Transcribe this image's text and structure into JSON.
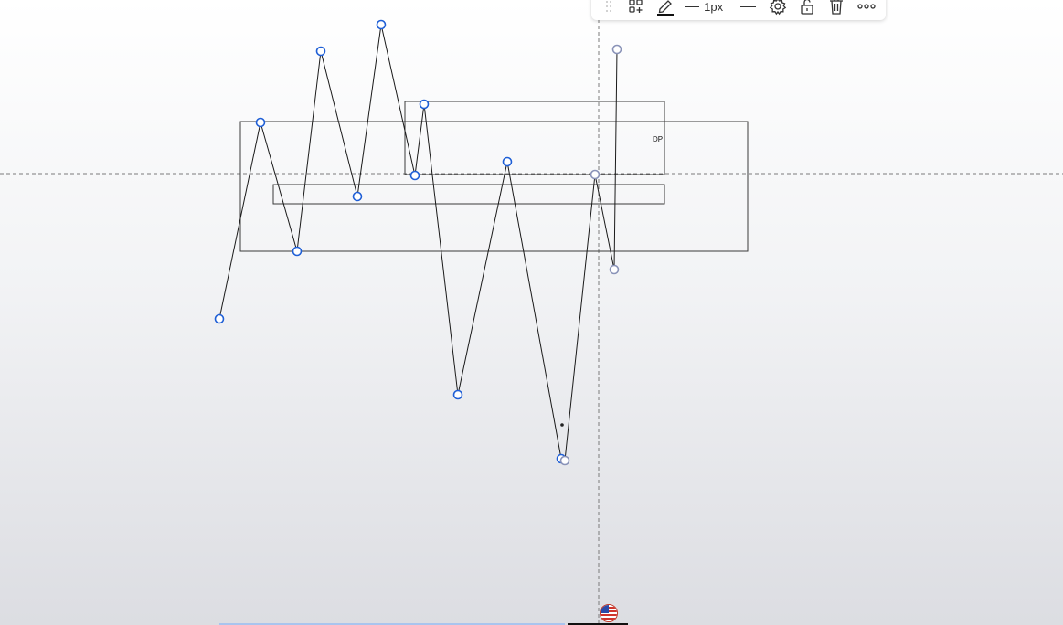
{
  "toolbar": {
    "drag_handle_icon": "drag-dots-icon",
    "add_template_icon": "grid-plus-icon",
    "pencil_icon": "pencil-icon",
    "pencil_color": "#111111",
    "line_width_label": "1px",
    "settings_icon": "gear-icon",
    "lock_icon": "unlock-icon",
    "delete_icon": "trash-icon",
    "more_icon": "more-dots-icon"
  },
  "drawing": {
    "rectangle_label": "DP",
    "handle_color": "#1f5fd6",
    "line_color": "#1a1a1a"
  },
  "footer": {
    "flag_icon": "us-flag-icon"
  }
}
